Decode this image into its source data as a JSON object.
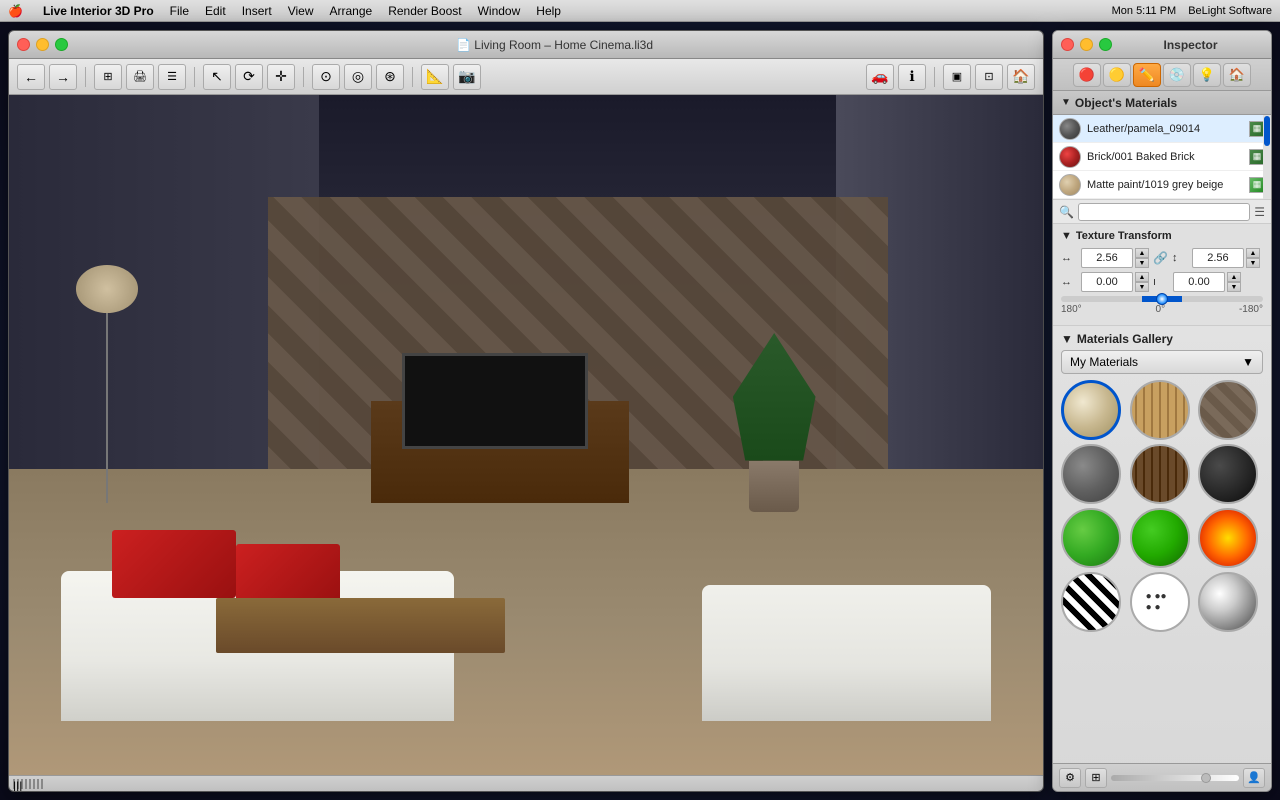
{
  "menubar": {
    "apple": "🍎",
    "items": [
      "Live Interior 3D Pro",
      "File",
      "Edit",
      "Insert",
      "View",
      "Arrange",
      "Render Boost",
      "Window",
      "Help"
    ],
    "right": {
      "time": "Mon 5:11 PM",
      "brand": "BeLight Software"
    }
  },
  "viewport": {
    "title": "Living Room – Home Cinema.li3d",
    "statusbar_handle": "|||"
  },
  "toolbar": {
    "buttons": [
      "←",
      "→",
      "⊞",
      "🖨",
      "⊟",
      "↖",
      "⟳",
      "✛",
      "⊙",
      "⊘",
      "⊛",
      "🔧",
      "📷",
      "🚗",
      "ℹ",
      "⊞",
      "⊞",
      "🏠"
    ]
  },
  "inspector": {
    "title": "Inspector",
    "tabs": [
      {
        "icon": "🔴",
        "label": "object",
        "active": false
      },
      {
        "icon": "🟡",
        "label": "material",
        "active": false
      },
      {
        "icon": "✏️",
        "label": "edit",
        "active": true
      },
      {
        "icon": "💿",
        "label": "library",
        "active": false
      },
      {
        "icon": "💡",
        "label": "light",
        "active": false
      },
      {
        "icon": "🏠",
        "label": "room",
        "active": false
      }
    ],
    "objects_materials": {
      "section_title": "Object's Materials",
      "materials": [
        {
          "name": "Leather/pamela_09014",
          "swatch": "gray"
        },
        {
          "name": "Brick/001 Baked Brick",
          "swatch": "red"
        },
        {
          "name": "Matte paint/1019 grey beige",
          "swatch": "tan"
        }
      ],
      "search_placeholder": "🔍"
    },
    "texture_transform": {
      "section_title": "Texture Transform",
      "scale_x": "2.56",
      "scale_y": "2.56",
      "offset_x": "0.00",
      "offset_y": "0.00",
      "rotation_label": "0°",
      "slider_min": "180°",
      "slider_mid": "0°",
      "slider_max": "-180°"
    },
    "gallery": {
      "section_title": "Materials Gallery",
      "dropdown_label": "My Materials",
      "items": [
        {
          "id": "mat1",
          "class": "mat-beige",
          "selected": true
        },
        {
          "id": "mat2",
          "class": "mat-wood-light",
          "selected": false
        },
        {
          "id": "mat3",
          "class": "mat-stone",
          "selected": false
        },
        {
          "id": "mat4",
          "class": "mat-concrete",
          "selected": false
        },
        {
          "id": "mat5",
          "class": "mat-wood-dark",
          "selected": false
        },
        {
          "id": "mat6",
          "class": "mat-dark",
          "selected": false
        },
        {
          "id": "mat7",
          "class": "mat-green",
          "selected": false
        },
        {
          "id": "mat8",
          "class": "mat-green2",
          "selected": false
        },
        {
          "id": "mat9",
          "class": "mat-fire",
          "selected": false
        },
        {
          "id": "mat10",
          "class": "mat-zebra",
          "selected": false
        },
        {
          "id": "mat11",
          "class": "mat-dalmatian",
          "selected": false
        },
        {
          "id": "mat12",
          "class": "mat-chrome",
          "selected": false
        }
      ]
    }
  }
}
